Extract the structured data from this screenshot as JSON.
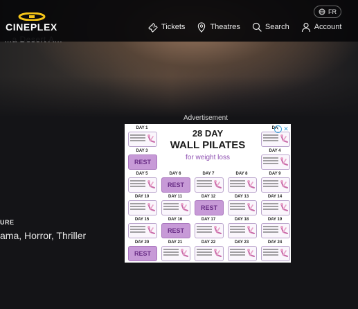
{
  "header": {
    "brand": "CINEPLEX",
    "language_button": "FR",
    "nav": [
      {
        "label": "Tickets",
        "icon": "ticket-icon"
      },
      {
        "label": "Theatres",
        "icon": "location-pin-icon"
      },
      {
        "label": "Search",
        "icon": "search-icon"
      },
      {
        "label": "Account",
        "icon": "user-icon"
      }
    ]
  },
  "hero": {
    "partial_text": "...a Desert A..."
  },
  "movie_info": {
    "genre_label": "URE",
    "genres": "ama, Horror, Thriller"
  },
  "advertisement": {
    "label": "Advertisement",
    "title_line1": "28 DAY",
    "title_line2": "WALL PILATES",
    "title_line3": "for weight loss",
    "rest_label": "REST",
    "days": [
      {
        "label": "DAY 1",
        "rest": false
      },
      {
        "label": "DAY 3",
        "rest": true
      },
      {
        "label": "DAY 5",
        "rest": false
      },
      {
        "label": "DAY 6",
        "rest": true
      },
      {
        "label": "DAY 7",
        "rest": false
      },
      {
        "label": "DAY 8",
        "rest": false
      },
      {
        "label": "DAY 9",
        "rest": false
      },
      {
        "label": "DAY 10",
        "rest": false
      },
      {
        "label": "DAY 11",
        "rest": false
      },
      {
        "label": "DAY 12",
        "rest": true
      },
      {
        "label": "DAY 13",
        "rest": false
      },
      {
        "label": "DAY 14",
        "rest": false
      },
      {
        "label": "DAY 15",
        "rest": false
      },
      {
        "label": "DAY 16",
        "rest": true
      },
      {
        "label": "DAY 17",
        "rest": false
      },
      {
        "label": "DAY 18",
        "rest": false
      },
      {
        "label": "DAY 19",
        "rest": false
      },
      {
        "label": "DAY 20",
        "rest": true
      },
      {
        "label": "DAY 21",
        "rest": false
      },
      {
        "label": "DAY 22",
        "rest": false
      },
      {
        "label": "DAY 23",
        "rest": false
      },
      {
        "label": "DAY 24",
        "rest": false
      },
      {
        "label": "DA",
        "rest": false
      },
      {
        "label": "DAY 4",
        "rest": false
      }
    ]
  },
  "colors": {
    "background": "#141417",
    "header": "#08080a",
    "brand_yellow": "#f5c518",
    "ad_rest": "#c79ad7",
    "ad_accent": "#8e4fb1"
  }
}
